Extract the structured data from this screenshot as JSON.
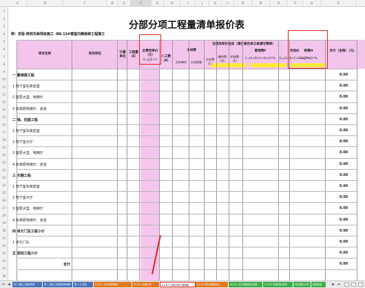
{
  "column_letters": [
    "A",
    "B",
    "C",
    "D",
    "E",
    "F",
    "G",
    "H",
    "I",
    "J",
    "K",
    "L",
    "M",
    "N",
    "O",
    "P",
    "Q",
    "R"
  ],
  "row_numbers": [
    "1",
    "2",
    "3",
    "4",
    "5",
    "6",
    "7",
    "8",
    "9",
    "10",
    "11",
    "12",
    "13",
    "14",
    "15",
    "16",
    "17",
    "18",
    "19",
    "20",
    "21",
    "22",
    "23",
    "24",
    "25",
    "26",
    "27",
    "28",
    "29",
    "30",
    "31",
    "32",
    "33",
    "34",
    "35",
    "36"
  ],
  "sheet": {
    "title": "分部分项工程量清单报价表",
    "subtitle": "称：京投·西郊华商项目施工 -B8-13#楼室内精装修工程施工",
    "headers": {
      "project_name": "项目名称",
      "project_feature": "项目特征",
      "unit": "计量单位",
      "quantity": "工程量（E）",
      "unit_price_line1": "全费用单价",
      "unit_price_line2": "（元）",
      "unit_price_formula": "K=∑(E~I)",
      "composition": "全费用单价组成（请在黄色单元格填写费率）",
      "labor": "人工费（A）",
      "material": "主材费",
      "material_price": "主材单价",
      "material_loss": "主材损耗",
      "aux_material": "主材费（C）",
      "aux_fee": "辅材费（D）",
      "machine": "机械费（E）",
      "mgmt": "管理费F",
      "mgmt_formula": "F=(A+B+C+D+E)*%",
      "profit": "利润G",
      "profit_formula": "G=(A+B+C+D+E)*%",
      "tax": "税费H",
      "tax_formula": "H=(A~G)*%",
      "total": "合计（含税）（元）"
    },
    "rows": [
      {
        "label": "一 暖通施工程",
        "value": "0.00",
        "bold": true
      },
      {
        "label": "1 地下室车库前室",
        "value": "0.00",
        "bold": false
      },
      {
        "label": "2 首层大堂、电梯厅",
        "value": "0.00",
        "bold": false
      },
      {
        "label": "3 标准层电梯厅、走道",
        "value": "0.00",
        "bold": false
      },
      {
        "label": "二 墙、柱面工程",
        "value": "0.00",
        "bold": true
      },
      {
        "label": "1 地下室车库前室",
        "value": "0.00",
        "bold": false
      },
      {
        "label": "2 地下室大厅",
        "value": "0.00",
        "bold": false
      },
      {
        "label": "3 首层大堂、电梯厅",
        "value": "0.00",
        "bold": false
      },
      {
        "label": "4 标准层电梯厅、走道",
        "value": "0.00",
        "bold": false
      },
      {
        "label": "三 天棚工程",
        "value": "0.00",
        "bold": true
      },
      {
        "label": "1 地下室车库前室",
        "value": "0.00",
        "bold": false
      },
      {
        "label": "2 地下室大厅",
        "value": "0.00",
        "bold": false
      },
      {
        "label": "3 首层大堂、电梯厅",
        "value": "0.00",
        "bold": false
      },
      {
        "label": "4 标准层电梯厅、走道",
        "value": "0.00",
        "bold": false
      },
      {
        "label": "四 单元门及工程小计",
        "value": "0.00",
        "bold": true
      },
      {
        "label": "1 单元门头",
        "value": "0.00",
        "bold": false
      },
      {
        "label": "五 其他工程小计",
        "value": "0.00",
        "bold": true
      },
      {
        "label": "合计",
        "value": "0.00",
        "bold": true
      }
    ]
  },
  "tabs": [
    {
      "label": "封1 招标工程量清单",
      "color": "#4a72b8",
      "active": false
    },
    {
      "label": "表-1 招标工程量清单说明",
      "color": "#4a72b8",
      "active": false
    },
    {
      "label": "表-2 汇总表",
      "color": "#4a72b8",
      "active": false
    },
    {
      "label": "A1-B-2 计价规费明细",
      "color": "#e07a22",
      "active": false
    },
    {
      "label": "A2-B-3 分部分项",
      "color": "#e07a22",
      "active": false
    },
    {
      "label": "A2-B-3 分部分项工程清单",
      "color": "#e07a22",
      "active": true
    },
    {
      "label": "A2-B-4 单价措施项目",
      "color": "#e07a22",
      "active": false
    },
    {
      "label": "A2-B-5 总价措施项目清单",
      "color": "#3fae49",
      "active": false
    },
    {
      "label": "A2-B-6 其他项目清单",
      "color": "#3fae49",
      "active": false
    },
    {
      "label": "材料暂估价表",
      "color": "#3fae49",
      "active": false
    },
    {
      "label": "规费税金",
      "color": "#3fae49",
      "active": false
    }
  ],
  "colors": {
    "header_pink": "#f4c5ec",
    "column_pink": "#f6c6ee",
    "rate_yellow": "#ffe93a",
    "highlight_red": "#e02020"
  },
  "icons": {
    "first_tab": "tab-first-icon",
    "prev_tab": "tab-prev-icon",
    "next_tab": "tab-next-icon",
    "last_tab": "tab-last-icon",
    "add_sheet": "add-sheet-icon"
  }
}
